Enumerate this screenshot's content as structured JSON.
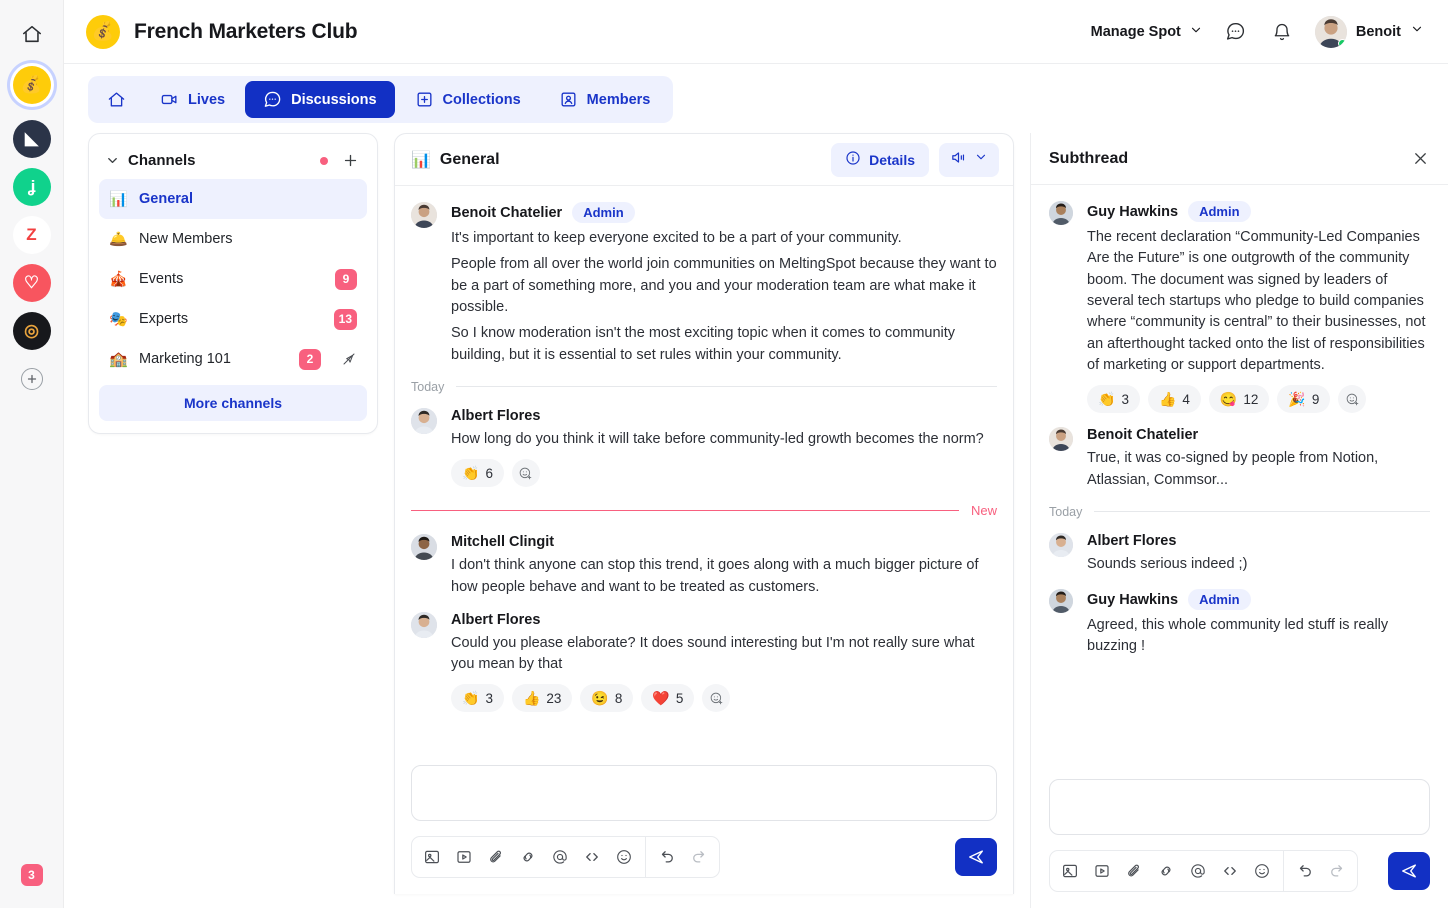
{
  "rail": {
    "home_icon": "home-icon",
    "workspaces": [
      {
        "name": "French Marketers Club",
        "emoji": "💰",
        "bg": "#fecc0a",
        "active": true
      },
      {
        "name": "workspace-2",
        "emoji": "◣",
        "bg": "#2b3448",
        "active": false
      },
      {
        "name": "workspace-3",
        "emoji": "ʝ",
        "bg": "#10d28c",
        "active": false
      },
      {
        "name": "workspace-4",
        "emoji": "Z",
        "bg": "#ffffff",
        "active": false
      },
      {
        "name": "workspace-5",
        "emoji": "♡",
        "bg": "#f8555f",
        "active": false
      },
      {
        "name": "workspace-6",
        "emoji": "◎",
        "bg": "#17181c",
        "active": false
      }
    ],
    "add_label": "+",
    "badge": "3"
  },
  "header": {
    "logo_emoji": "💰",
    "title": "French Marketers Club",
    "manage_spot_label": "Manage Spot",
    "chat_icon": "chat-bubble-icon",
    "bell_icon": "bell-icon",
    "user_name": "Benoit"
  },
  "nav": {
    "tabs": [
      {
        "label": "",
        "icon": "home-icon",
        "active": false
      },
      {
        "label": "Lives",
        "icon": "video-icon",
        "active": false
      },
      {
        "label": "Discussions",
        "icon": "chat-bubble-icon",
        "active": true
      },
      {
        "label": "Collections",
        "icon": "plus-square-icon",
        "active": false
      },
      {
        "label": "Members",
        "icon": "person-card-icon",
        "active": false
      }
    ]
  },
  "channels": {
    "title": "Channels",
    "more_label": "More channels",
    "items": [
      {
        "emoji": "📊",
        "label": "General",
        "badge": "",
        "muted": false,
        "active": true
      },
      {
        "emoji": "🛎️",
        "label": "New Members",
        "badge": "",
        "muted": false,
        "active": false
      },
      {
        "emoji": "🎪",
        "label": "Events",
        "badge": "9",
        "muted": false,
        "active": false
      },
      {
        "emoji": "🎭",
        "label": "Experts",
        "badge": "13",
        "muted": false,
        "active": false
      },
      {
        "emoji": "🏫",
        "label": "Marketing 101",
        "badge": "2",
        "muted": true,
        "active": false
      }
    ]
  },
  "discussion": {
    "channel_emoji": "📊",
    "channel_name": "General",
    "details_label": "Details",
    "divider_today": "Today",
    "divider_new": "New",
    "messages": [
      {
        "author": "Benoit Chatelier",
        "admin": "Admin",
        "paragraphs": [
          "It's important to keep everyone excited to be a part of your community.",
          "People from all over the world join communities on MeltingSpot because they want to be a part of something more, and you and your moderation team are what make it possible.",
          "So I know moderation isn't the most exciting topic when it comes to community building, but it is essential to set rules within your community."
        ],
        "reactions": []
      },
      {
        "author": "Albert Flores",
        "admin": "",
        "paragraphs": [
          "How long do you think it will take before community-led growth becomes the norm?"
        ],
        "reactions": [
          {
            "emoji": "👏",
            "count": "6"
          }
        ]
      },
      {
        "author": "Mitchell Clingit",
        "admin": "",
        "paragraphs": [
          "I don't think anyone can stop this trend, it goes along with a much bigger picture of how people behave and want to be treated as customers."
        ],
        "reactions": []
      },
      {
        "author": "Albert Flores",
        "admin": "",
        "paragraphs": [
          "Could you please elaborate? It does sound interesting but I'm not really sure what you mean by that"
        ],
        "reactions": [
          {
            "emoji": "👏",
            "count": "3"
          },
          {
            "emoji": "👍",
            "count": "23"
          },
          {
            "emoji": "😉",
            "count": "8"
          },
          {
            "emoji": "❤️",
            "count": "5"
          }
        ]
      }
    ],
    "composer": {
      "value": "",
      "placeholder": "",
      "tools": [
        "image-icon",
        "video-icon",
        "attachment-icon",
        "link-icon",
        "mention-icon",
        "code-icon",
        "emoji-icon"
      ],
      "undo": "undo-icon",
      "redo": "redo-icon",
      "send": "send-icon"
    }
  },
  "subthread": {
    "title": "Subthread",
    "close_icon": "close-icon",
    "divider_today": "Today",
    "messages": [
      {
        "author": "Guy Hawkins",
        "admin": "Admin",
        "paragraphs": [
          "The recent declaration “Community-Led Companies Are the Future” is one outgrowth of the community boom. The document was signed by leaders of several tech startups who pledge to build companies where “community is central” to their businesses, not an afterthought tacked onto the list of responsibilities of marketing or support departments."
        ],
        "reactions": [
          {
            "emoji": "👏",
            "count": "3"
          },
          {
            "emoji": "👍",
            "count": "4"
          },
          {
            "emoji": "😋",
            "count": "12"
          },
          {
            "emoji": "🎉",
            "count": "9"
          }
        ]
      },
      {
        "author": "Benoit Chatelier",
        "admin": "",
        "paragraphs": [
          "True, it was co-signed by people from Notion, Atlassian, Commsor..."
        ],
        "reactions": []
      },
      {
        "author": "Albert Flores",
        "admin": "",
        "paragraphs": [
          "Sounds serious indeed ;)"
        ],
        "reactions": []
      },
      {
        "author": "Guy Hawkins",
        "admin": "Admin",
        "paragraphs": [
          "Agreed, this whole community led stuff is really buzzing !"
        ],
        "reactions": []
      }
    ],
    "composer": {
      "value": "",
      "placeholder": ""
    }
  },
  "colors": {
    "accent": "#1230c4",
    "accent_soft": "#eef1fe",
    "badge_pink": "#f8607f",
    "brand_yellow": "#fecc0a"
  }
}
